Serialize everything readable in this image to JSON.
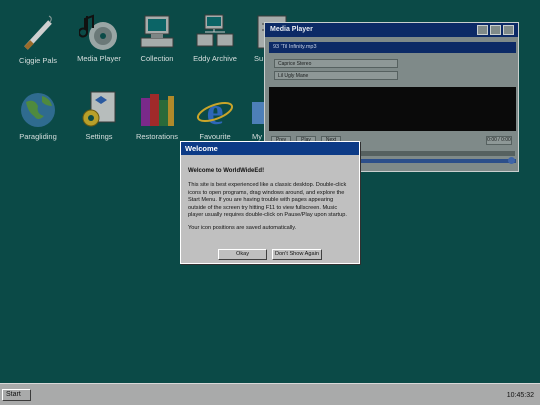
{
  "desktop_icons": [
    {
      "label": "Ciggie Pals",
      "icon": "cigarette-icon"
    },
    {
      "label": "Media Player",
      "icon": "music-cd-icon"
    },
    {
      "label": "Collection",
      "icon": "computer-icon"
    },
    {
      "label": "Eddy Archive",
      "icon": "network-computers-icon"
    },
    {
      "label": "Su",
      "icon": "notepad-icon"
    },
    {
      "label": "Paragliding",
      "icon": "globe-icon"
    },
    {
      "label": "Settings",
      "icon": "settings-document-icon"
    },
    {
      "label": "Restorations",
      "icon": "books-icon"
    },
    {
      "label": "Favourite",
      "icon": "internet-explorer-icon"
    },
    {
      "label": "My c",
      "icon": "folder-icon"
    }
  ],
  "media_player": {
    "title": "Media Player",
    "current_track": "93 'Til Infinity.mp3",
    "playlist": [
      "Caprice Stereo",
      "Lil Ugly Mane"
    ],
    "buttons": {
      "prev": "Prev",
      "play": "Play",
      "next": "Next"
    },
    "time": "0:00 / 0:00",
    "progress": 0.0,
    "volume": 0.97
  },
  "welcome_dialog": {
    "title": "Welcome",
    "heading": "Welcome to WorldWideEd!",
    "paragraph1": "This site is best experienced like a classic desktop. Double-click icons to open programs, drag windows around, and explore the Start Menu. If you are having trouble with pages appearing outside of the screen try hitting F11 to view fullscreen. Music player usually requires double-click on Pause/Play upon startup.",
    "paragraph2": "Your icon positions are saved automatically.",
    "ok_label": "Okay",
    "dont_show_label": "Don't Show Again"
  },
  "taskbar": {
    "start_label": "Start",
    "clock": "10:45:32"
  }
}
